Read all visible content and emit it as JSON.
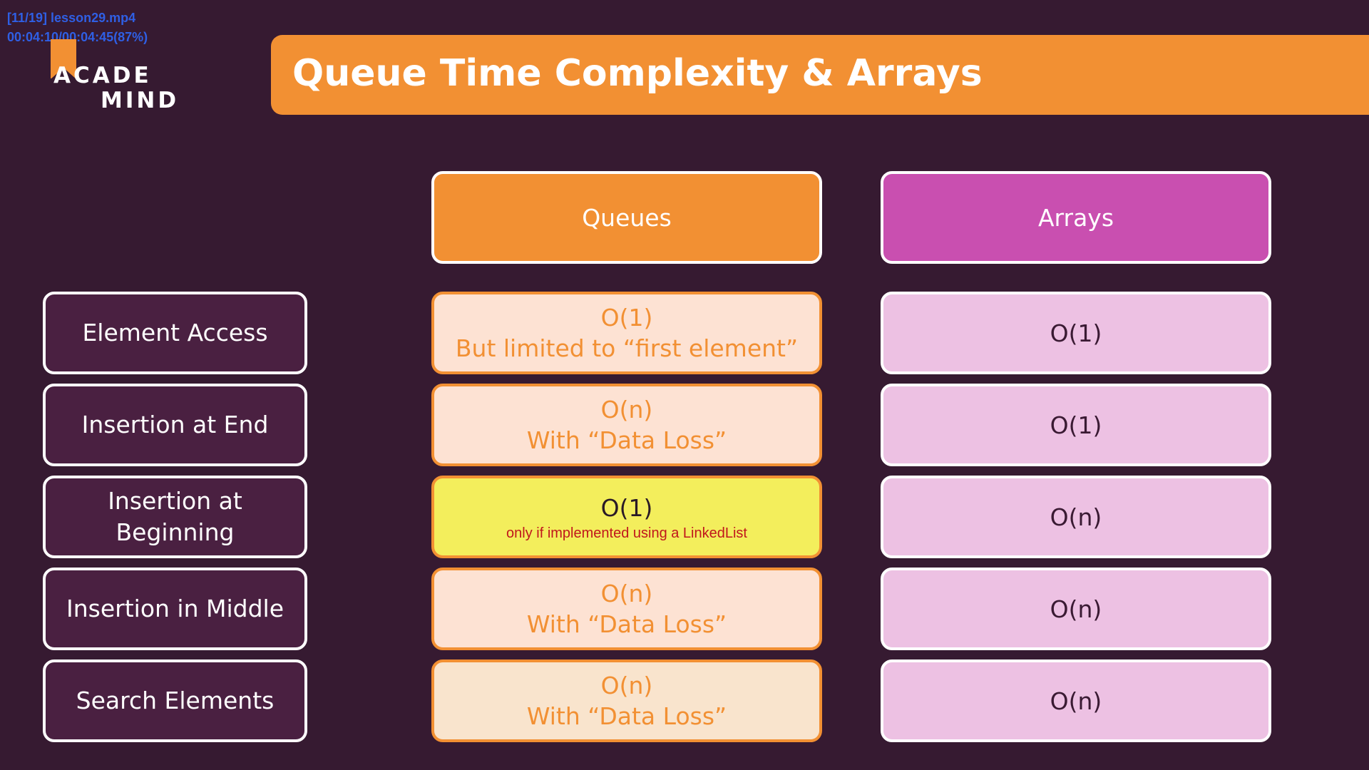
{
  "overlay": {
    "file": "[11/19] lesson29.mp4",
    "time": "00:04:10/00:04:45(87%)"
  },
  "logo": {
    "line1": "ACADE",
    "line2": "MIND",
    "accent_color": "#f29033"
  },
  "title": "Queue Time Complexity & Arrays",
  "columns": {
    "queues": "Queues",
    "arrays": "Arrays"
  },
  "rows": [
    {
      "label": "Element Access",
      "queue_line1": "O(1)",
      "queue_line2": "But limited to “first element”",
      "array": "O(1)"
    },
    {
      "label": "Insertion at End",
      "queue_line1": "O(n)",
      "queue_line2": "With “Data Loss”",
      "array": "O(1)"
    },
    {
      "label": "Insertion at Beginning",
      "queue_line1": "O(1)",
      "queue_note": "only if implemented using a LinkedList",
      "array": "O(n)"
    },
    {
      "label": "Insertion in Middle",
      "queue_line1": "O(n)",
      "queue_line2": "With “Data Loss”",
      "array": "O(n)"
    },
    {
      "label": "Search Elements",
      "queue_line1": "O(n)",
      "queue_line2": "With “Data Loss”",
      "array": "O(n)"
    }
  ],
  "colors": {
    "background": "#361a31",
    "queue_accent": "#f29033",
    "array_accent": "#c94fb0",
    "highlight": "#f3ee5c",
    "note_text": "#c0161c"
  }
}
